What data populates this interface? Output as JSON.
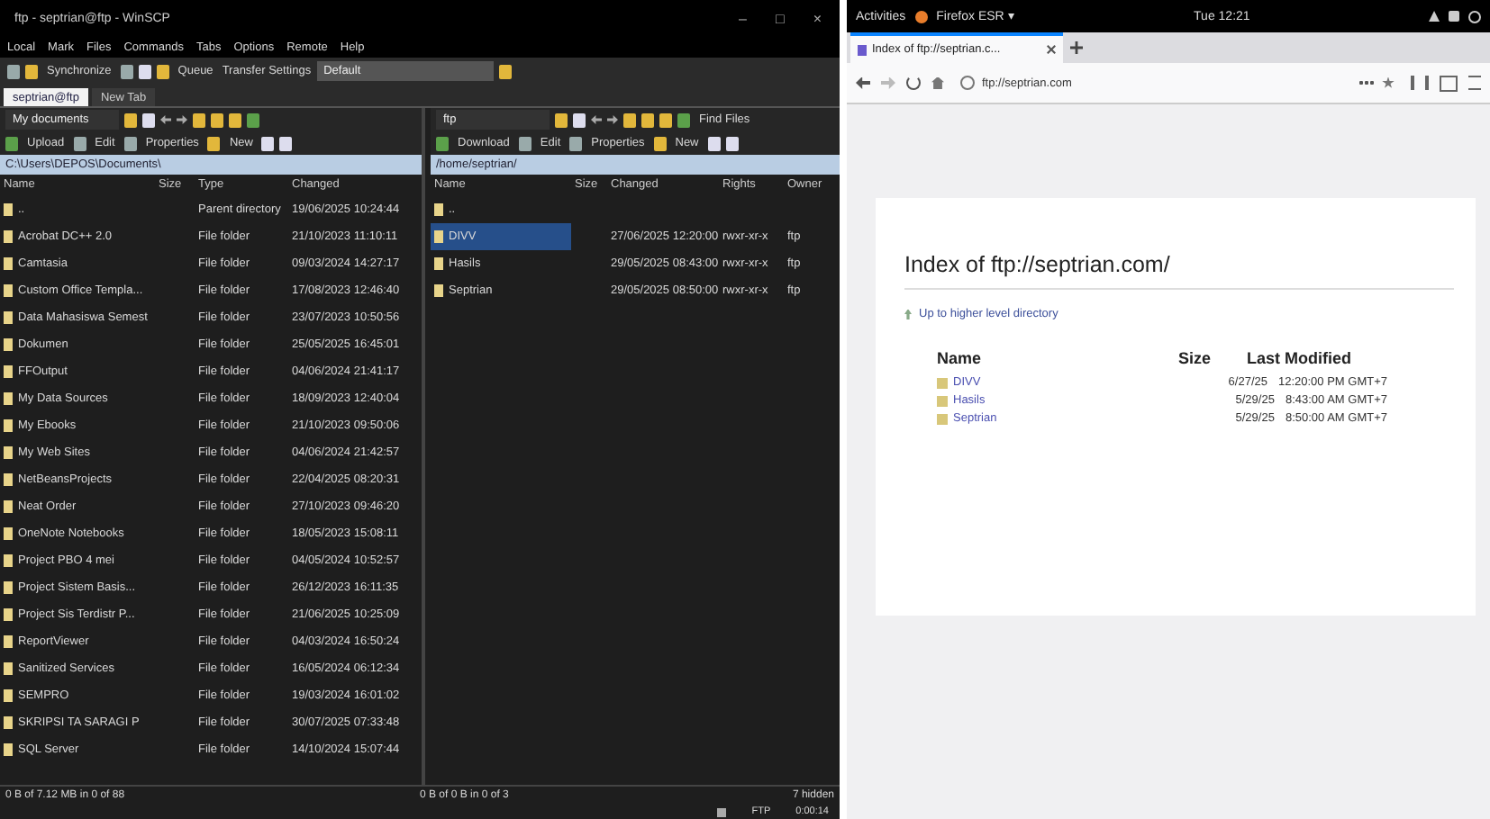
{
  "commander": {
    "title": "ftp - septrian@ftp - WinSCP",
    "window_controls": [
      "–",
      "□",
      "×"
    ],
    "menu": [
      "Local",
      "Mark",
      "Files",
      "Commands",
      "Tabs",
      "Options",
      "Remote",
      "Help"
    ],
    "toolbar": {
      "synchronize": "Synchronize",
      "queue": "Queue",
      "transfer_label": "Transfer Settings",
      "transfer_value": "Default"
    },
    "tabs": [
      {
        "label": "septrian@ftp",
        "selected": true
      },
      {
        "label": "New Tab",
        "selected": false
      }
    ],
    "local": {
      "location": "My documents",
      "actions": [
        "Upload",
        "Edit",
        "Properties",
        "New"
      ],
      "path": "C:\\Users\\DEPOS\\Documents\\",
      "columns": [
        "Name",
        "Size",
        "Type",
        "Changed"
      ],
      "rows": [
        {
          "name": "..",
          "type": "Parent directory",
          "changed": "19/06/2025 10:24:44"
        },
        {
          "name": "Acrobat DC++ 2.0",
          "type": "File folder",
          "changed": "21/10/2023 11:10:11"
        },
        {
          "name": "Camtasia",
          "type": "File folder",
          "changed": "09/03/2024 14:27:17"
        },
        {
          "name": "Custom Office Templa...",
          "type": "File folder",
          "changed": "17/08/2023 12:46:40"
        },
        {
          "name": "Data Mahasiswa Semest",
          "type": "File folder",
          "changed": "23/07/2023 10:50:56"
        },
        {
          "name": "Dokumen",
          "type": "File folder",
          "changed": "25/05/2025 16:45:01"
        },
        {
          "name": "FFOutput",
          "type": "File folder",
          "changed": "04/06/2024 21:41:17"
        },
        {
          "name": "My Data Sources",
          "type": "File folder",
          "changed": "18/09/2023 12:40:04"
        },
        {
          "name": "My Ebooks",
          "type": "File folder",
          "changed": "21/10/2023 09:50:06"
        },
        {
          "name": "My Web Sites",
          "type": "File folder",
          "changed": "04/06/2024 21:42:57"
        },
        {
          "name": "NetBeansProjects",
          "type": "File folder",
          "changed": "22/04/2025 08:20:31"
        },
        {
          "name": "Neat Order",
          "type": "File folder",
          "changed": "27/10/2023 09:46:20"
        },
        {
          "name": "OneNote Notebooks",
          "type": "File folder",
          "changed": "18/05/2023 15:08:11"
        },
        {
          "name": "Project PBO 4 mei",
          "type": "File folder",
          "changed": "04/05/2024 10:52:57"
        },
        {
          "name": "Project Sistem Basis...",
          "type": "File folder",
          "changed": "26/12/2023 16:11:35"
        },
        {
          "name": "Project Sis Terdistr P...",
          "type": "File folder",
          "changed": "21/06/2025 10:25:09"
        },
        {
          "name": "ReportViewer",
          "type": "File folder",
          "changed": "04/03/2024 16:50:24"
        },
        {
          "name": "Sanitized Services",
          "type": "File folder",
          "changed": "16/05/2024 06:12:34"
        },
        {
          "name": "SEMPRO",
          "type": "File folder",
          "changed": "19/03/2024 16:01:02"
        },
        {
          "name": "SKRIPSI TA SARAGI P",
          "type": "File folder",
          "changed": "30/07/2025 07:33:48"
        },
        {
          "name": "SQL Server",
          "type": "File folder",
          "changed": "14/10/2024 15:07:44"
        }
      ],
      "status": "0 B of 7.12 MB in 0 of 88"
    },
    "remote": {
      "location": "ftp",
      "actions": [
        "Download",
        "Edit",
        "Properties",
        "New"
      ],
      "find": "Find Files",
      "path": "/home/septrian/",
      "columns": [
        "Name",
        "Size",
        "Changed",
        "Rights",
        "Owner"
      ],
      "rows": [
        {
          "name": "..",
          "changed": "",
          "rights": "",
          "owner": "",
          "selected": false
        },
        {
          "name": "DIVV",
          "changed": "27/06/2025 12:20:00",
          "rights": "rwxr-xr-x",
          "owner": "ftp",
          "selected": true
        },
        {
          "name": "Hasils",
          "changed": "29/05/2025 08:43:00",
          "rights": "rwxr-xr-x",
          "owner": "ftp",
          "selected": false
        },
        {
          "name": "Septrian",
          "changed": "29/05/2025 08:50:00",
          "rights": "rwxr-xr-x",
          "owner": "ftp",
          "selected": false
        }
      ],
      "status": "0 B of 0 B in 0 of 3",
      "hidden": "7 hidden"
    },
    "statusbar": {
      "protocol": "FTP",
      "time": "0:00:14"
    }
  },
  "desktop": {
    "activities": "Activities",
    "app": "Firefox ESR ▾",
    "clock": "Tue 12:21"
  },
  "browser": {
    "tab": {
      "label": "Index of ftp://septrian.c...",
      "selected": true
    },
    "url": "ftp://septrian.com",
    "page": {
      "heading": "Index of ftp://septrian.com/",
      "up_link": "Up to higher level directory",
      "columns": [
        "Name",
        "Size",
        "Last Modified"
      ],
      "rows": [
        {
          "name": "DIVV",
          "date": "6/27/25",
          "time": "12:20:00 PM GMT+7"
        },
        {
          "name": "Hasils",
          "date": "5/29/25",
          "time": "8:43:00 AM GMT+7"
        },
        {
          "name": "Septrian",
          "date": "5/29/25",
          "time": "8:50:00 AM GMT+7"
        }
      ]
    }
  }
}
